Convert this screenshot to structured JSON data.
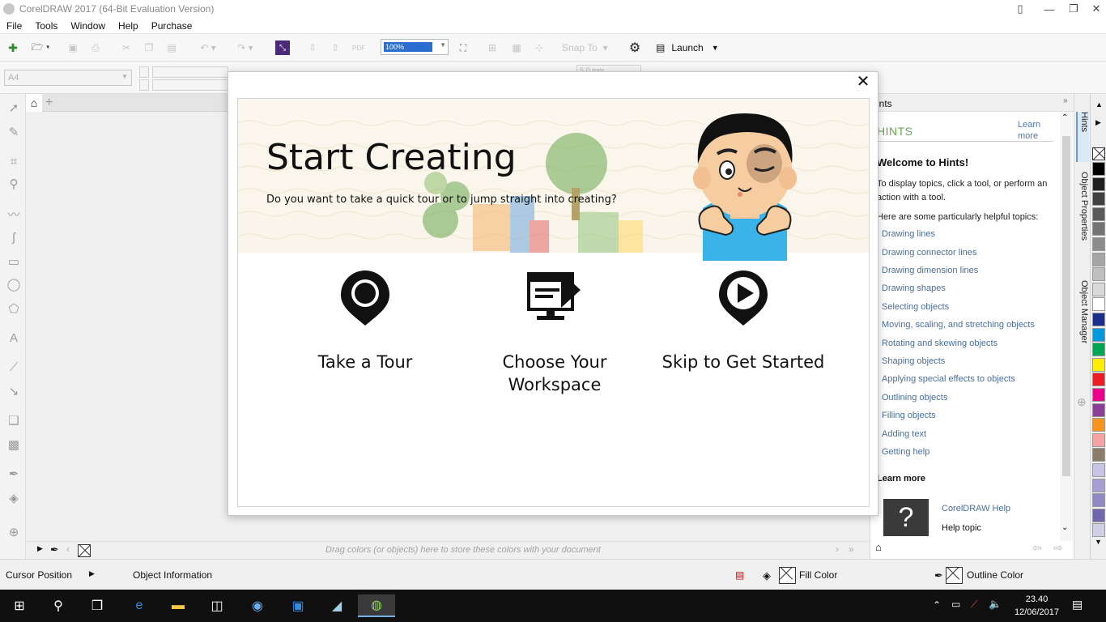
{
  "window": {
    "title": "CorelDRAW 2017 (64-Bit Evaluation Version)"
  },
  "menu": [
    "File",
    "Tools",
    "Window",
    "Help",
    "Purchase"
  ],
  "toolbar": {
    "zoom_value": "100%",
    "snap_to": "Snap To",
    "launch": "Launch",
    "pdf": "PDF"
  },
  "propbar": {
    "page_size": "A4",
    "nudge": "5.0 mm"
  },
  "palette_tray": {
    "hint": "Drag colors (or objects) here to store these colors with your document"
  },
  "status": {
    "cursor_position": "Cursor Position",
    "object_information": "Object Information",
    "fill_color": "Fill Color",
    "outline_color": "Outline Color"
  },
  "welcome": {
    "title": "Start Creating",
    "question": "Do you want to take a quick tour or to jump straight into creating?",
    "options": [
      {
        "label": "Take a Tour",
        "icon": "location-pin-icon"
      },
      {
        "label": "Choose Your Workspace",
        "icon": "workspace-monitor-icon"
      },
      {
        "label": "Skip to Get Started",
        "icon": "play-pin-icon"
      }
    ]
  },
  "hints": {
    "panel_title": "ints",
    "heading": "HINTS",
    "learn_more_top": "Learn more",
    "welcome": "Welcome to Hints!",
    "intro": "To display topics, click a tool, or perform an action with a tool.",
    "helpful": "Here are some particularly helpful topics:",
    "topics": [
      "Drawing lines",
      "Drawing connector lines",
      "Drawing dimension lines",
      "Drawing shapes",
      "Selecting objects",
      "Moving, scaling, and stretching objects",
      "Rotating and skewing objects",
      "Shaping objects",
      "Applying special effects to objects",
      "Outlining objects",
      "Filling objects",
      "Adding text",
      "Getting help"
    ],
    "learn_more": "Learn more",
    "help_link": "CorelDRAW Help",
    "help_topic": "Help topic"
  },
  "docker_tabs": [
    "Hints",
    "Object Properties",
    "Object Manager"
  ],
  "palette_colors": [
    "#000000",
    "#202020",
    "#404040",
    "#5a5a5a",
    "#737373",
    "#8c8c8c",
    "#a6a6a6",
    "#bfbfbf",
    "#d9d9d9",
    "#ffffff",
    "#1b2f8a",
    "#0099dd",
    "#00a651",
    "#ffed00",
    "#ee1c24",
    "#ec008c",
    "#8b3f97",
    "#f7941d",
    "#f5a3a3",
    "#8c7d6b",
    "#c9c3e6",
    "#a6a0d2",
    "#8f8ac3",
    "#6f68ad",
    "#cfcfe8"
  ],
  "taskbar": {
    "time": "23.40",
    "date": "12/06/2017"
  }
}
